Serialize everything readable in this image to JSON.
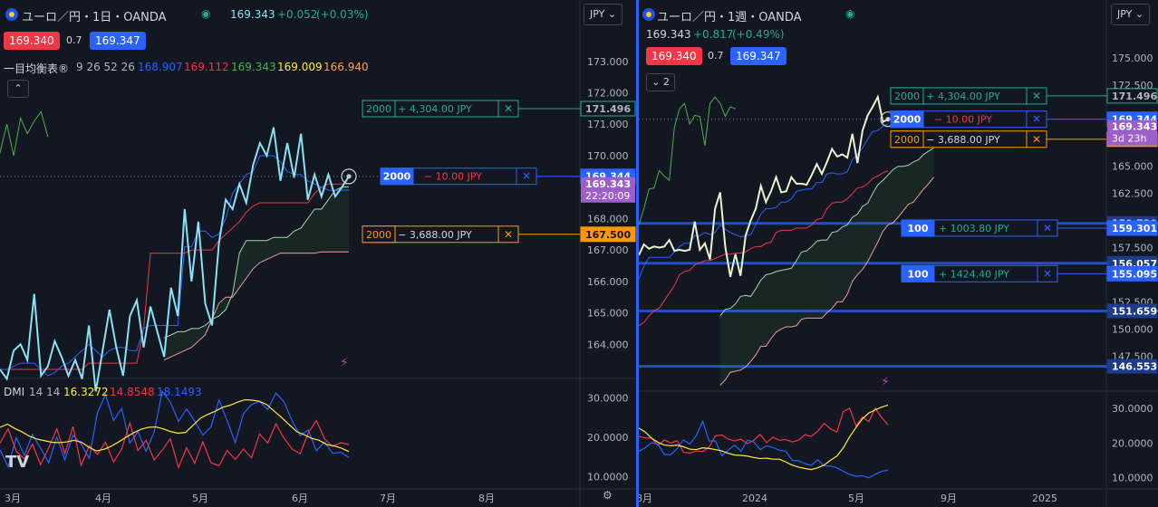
{
  "left": {
    "title": "ユーロ／円・1日・OANDA",
    "last": "169.343",
    "change": "+0.052",
    "change_pct": "(+0.03%)",
    "sell": "169.340",
    "spread": "0.7",
    "buy": "169.347",
    "currency": "JPY",
    "ichimoku_label": "一目均衡表®",
    "ichimoku_params": "9 26 52 26",
    "ichimoku_values": [
      "168.907",
      "169.112",
      "169.343",
      "169.009",
      "166.940"
    ],
    "collapse_icon": "chevron-up-icon",
    "dmi_label": "DMI",
    "dmi_params": "14 14",
    "dmi_values": [
      "16.3272",
      "14.8548",
      "18.1493"
    ],
    "logo": "TV",
    "axis_ticks": [
      "173.000",
      "172.000",
      "171.000",
      "170.000",
      "168.000",
      "167.000",
      "166.000",
      "165.000",
      "164.000"
    ],
    "dmi_ticks": [
      "30.0000",
      "20.0000",
      "10.0000"
    ],
    "x_ticks": [
      "3月",
      "4月",
      "5月",
      "6月",
      "7月",
      "8月"
    ],
    "orders": [
      {
        "qty": "2000",
        "pnl": "+ 4,304.00 JPY",
        "price": "171.496",
        "kind": "tp"
      },
      {
        "qty": "2000",
        "pnl": "− 10.00 JPY",
        "price": "169.344",
        "kind": "entry"
      },
      {
        "qty": "2000",
        "pnl": "− 3,688.00 JPY",
        "price": "167.500",
        "kind": "sl"
      }
    ],
    "price_tag": "169.343",
    "countdown": "22:20:09",
    "colors": {
      "conv": "#2962ff",
      "base": "#f23645",
      "lag": "#4caf50",
      "spanA": "#a5d6a7",
      "spanB": "#ef9a9a",
      "close": "#89e1f5",
      "adx": "#ffeb3b"
    }
  },
  "right": {
    "title": "ユーロ／円・1週・OANDA",
    "last": "169.343",
    "change": "+0.817",
    "change_pct": "(+0.49%)",
    "sell": "169.340",
    "spread": "0.7",
    "buy": "169.347",
    "currency": "JPY",
    "collapsed_count": "2",
    "axis_ticks": [
      "175.000",
      "172.500",
      "165.000",
      "162.500",
      "157.500",
      "152.500",
      "150.000",
      "147.500"
    ],
    "dmi_ticks": [
      "30.0000",
      "20.0000",
      "10.0000"
    ],
    "x_ticks": [
      "8月",
      "2024",
      "5月",
      "9月",
      "2025"
    ],
    "orders": [
      {
        "qty": "2000",
        "pnl": "+ 4,304.00 JPY",
        "price": "171.496",
        "kind": "tp"
      },
      {
        "qty": "2000",
        "pnl": "− 10.00 JPY",
        "price": "169.344",
        "kind": "entry"
      },
      {
        "qty": "2000",
        "pnl": "− 3,688.00 JPY",
        "price": "167.500",
        "kind": "sl"
      },
      {
        "qty": "100",
        "pnl": "+ 1003.80 JPY",
        "price": "159.301",
        "kind": "entry100"
      },
      {
        "qty": "100",
        "pnl": "+ 1424.40 JPY",
        "price": "155.095",
        "kind": "entry100"
      }
    ],
    "hlines": [
      "159.739",
      "156.057",
      "151.659",
      "146.553"
    ],
    "price_tag": "169.343",
    "countdown": "3d 23h"
  },
  "chart_data": [
    {
      "type": "line",
      "title": "ユーロ／円・1日・OANDA",
      "x": [
        "3月",
        "4月",
        "5月",
        "6月",
        "7月",
        "8月"
      ],
      "series": [
        {
          "name": "close",
          "values": [
            163.2,
            162.9,
            163.8,
            164.0,
            163.5,
            165.6,
            163.0,
            163.3,
            164.1,
            163.6,
            163.0,
            163.5,
            162.9,
            164.6,
            162.5,
            163.8,
            165.1,
            163.9,
            163.0,
            164.9,
            165.4,
            163.9,
            165.2,
            164.4,
            163.6,
            165.8,
            164.9,
            168.3,
            166.0,
            167.9,
            165.3,
            164.6,
            167.2,
            168.6,
            168.3,
            169.1,
            168.5,
            169.7,
            170.4,
            170.0,
            170.9,
            169.2,
            170.4,
            169.3,
            170.7,
            168.6,
            169.4,
            168.7,
            169.4,
            168.7,
            169.0,
            169.34
          ]
        },
        {
          "name": "conversion",
          "values": [
            163.2,
            163.2,
            163.3,
            163.4,
            163.4,
            163.4,
            163.2,
            163.0,
            163.1,
            163.3,
            163.4,
            163.6,
            163.8,
            164.0,
            163.8,
            163.6,
            163.8,
            163.9,
            163.9,
            163.8,
            163.8,
            164.5,
            164.6,
            164.6,
            164.6,
            164.6,
            164.6,
            167.1,
            167.1,
            167.6,
            167.6,
            167.4,
            167.5,
            168.0,
            168.8,
            169.1,
            169.4,
            169.5,
            170.0,
            170.0,
            170.0,
            169.8,
            169.5,
            169.4,
            169.4,
            169.2,
            169.1,
            169.0,
            168.9,
            168.9,
            168.9,
            168.907
          ]
        },
        {
          "name": "base",
          "values": [
            163.2,
            163.2,
            163.2,
            163.2,
            163.2,
            163.2,
            163.2,
            163.2,
            163.2,
            163.2,
            163.2,
            163.2,
            163.2,
            163.4,
            163.4,
            163.4,
            163.4,
            163.4,
            163.4,
            163.4,
            163.4,
            164.5,
            166.9,
            166.9,
            166.9,
            166.9,
            166.9,
            166.9,
            167.0,
            167.0,
            167.0,
            167.0,
            167.3,
            167.5,
            167.7,
            167.9,
            168.2,
            168.4,
            168.5,
            168.5,
            168.5,
            168.5,
            168.5,
            168.5,
            168.5,
            168.5,
            168.8,
            169.0,
            169.1,
            169.1,
            169.1,
            169.112
          ]
        },
        {
          "name": "leading_a",
          "values": [
            164.2,
            164.3,
            164.4,
            164.4,
            164.5,
            164.5,
            164.6,
            164.8,
            164.9,
            165.1,
            165.6,
            166.9,
            167.3,
            167.3,
            167.3,
            167.3,
            167.4,
            167.4,
            167.4,
            167.6,
            167.7,
            168.0,
            168.3,
            168.3,
            168.6,
            168.9,
            169.0,
            169.009
          ]
        },
        {
          "name": "leading_b",
          "values": [
            163.5,
            163.6,
            163.7,
            163.8,
            163.9,
            164.1,
            164.3,
            164.8,
            165.3,
            165.5,
            165.5,
            165.8,
            166.1,
            166.4,
            166.6,
            166.7,
            166.8,
            166.9,
            166.9,
            166.9,
            166.9,
            166.9,
            166.9,
            166.94,
            166.94,
            166.94,
            166.94,
            166.94
          ]
        },
        {
          "name": "lagging",
          "values": [
            165.5,
            165.8,
            166.5,
            165.9,
            167.2,
            167.6,
            166.8,
            165.4,
            164.6,
            165.1,
            164.7,
            166.2,
            165.3,
            167.8,
            167.4,
            168.9,
            168.0,
            169.8,
            168.9,
            169.3,
            170.7,
            169.6,
            170.3,
            169.4,
            170.1,
            170.5,
            170.1,
            171.0,
            170.0,
            171.2,
            170.7,
            171.1,
            171.4,
            170.6
          ]
        }
      ],
      "dmi": {
        "adx": [
          22.5,
          23.3,
          22.2,
          21.3,
          20.2,
          19.5,
          19.1,
          18.7,
          18.6,
          18.8,
          19.2,
          18.7,
          17.4,
          16.5,
          16.9,
          17.7,
          18.8,
          20.0,
          21.1,
          22.0,
          22.5,
          22.6,
          22.1,
          21.4,
          21.0,
          21.2,
          23.0,
          24.8,
          25.8,
          26.6,
          27.6,
          28.1,
          28.9,
          29.5,
          29.4,
          29.1,
          28.2,
          26.5,
          24.9,
          23.1,
          21.4,
          20.6,
          19.7,
          19.2,
          18.1,
          17.8,
          17.2,
          16.3272
        ],
        "plus_di": [
          16.8,
          12.5,
          19.9,
          15.4,
          20.7,
          17.2,
          13.5,
          20.0,
          14.2,
          20.5,
          18.3,
          14.6,
          26.1,
          30.8,
          24.2,
          27.3,
          18.5,
          21.4,
          16.4,
          21.3,
          31.6,
          28.9,
          24.0,
          27.2,
          24.1,
          20.5,
          22.6,
          29.5,
          24.2,
          18.6,
          25.9,
          28.3,
          29.1,
          27.0,
          31.2,
          29.0,
          24.2,
          20.4,
          21.8,
          16.5,
          18.8,
          15.9,
          16.1,
          14.8548
        ],
        "minus_di": [
          18.5,
          22.1,
          16.4,
          14.5,
          18.2,
          13.0,
          17.3,
          22.1,
          15.8,
          22.7,
          12.8,
          17.8,
          15.6,
          18.7,
          13.7,
          17.0,
          23.6,
          16.6,
          19.2,
          14.2,
          16.7,
          19.6,
          12.3,
          17.3,
          13.4,
          18.8,
          13.5,
          12.7,
          16.6,
          14.3,
          17.0,
          14.7,
          20.8,
          18.5,
          23.4,
          19.8,
          17.0,
          15.8,
          21.1,
          24.2,
          19.6,
          17.6,
          18.6,
          18.1493
        ],
        "ylim": [
          8,
          34
        ]
      },
      "ylim": [
        163.0,
        173.8
      ]
    },
    {
      "type": "line",
      "title": "ユーロ／円・1週・OANDA",
      "x": [
        "8月",
        "2024",
        "5月",
        "9月",
        "2025"
      ],
      "series": [
        {
          "name": "close",
          "values": [
            156.8,
            157.8,
            157.4,
            157.6,
            157.5,
            157.6,
            158.2,
            157.2,
            157.3,
            157.2,
            157.3,
            159.9,
            157.3,
            157.9,
            156.4,
            161.1,
            162.6,
            157.6,
            154.8,
            156.9,
            154.9,
            158.6,
            160.0,
            161.1,
            163.2,
            161.7,
            162.7,
            164.0,
            162.6,
            162.7,
            164.0,
            163.4,
            163.4,
            163.3,
            164.2,
            165.2,
            164.3,
            165.4,
            166.6,
            165.9,
            166.1,
            165.8,
            168.0,
            165.3,
            168.3,
            169.7,
            170.5,
            171.4,
            169.1,
            169.343
          ]
        },
        {
          "name": "conversion",
          "values": [
            154.6,
            155.8,
            156.6,
            156.6,
            156.6,
            156.6,
            156.6,
            157.1,
            157.6,
            157.9,
            157.9,
            158.6,
            158.6,
            158.9,
            158.7,
            158.9,
            159.6,
            159.2,
            158.9,
            158.7,
            158.5,
            158.6,
            158.7,
            159.6,
            160.6,
            161.1,
            161.1,
            161.2,
            161.7,
            161.7,
            162.0,
            162.7,
            162.8,
            162.9,
            162.9,
            163.5,
            163.5,
            164.3,
            164.4,
            164.3,
            164.3,
            164.5,
            165.6,
            166.1,
            166.7,
            167.5,
            168.2,
            168.3,
            168.7,
            168.907
          ]
        },
        {
          "name": "base",
          "values": [
            150.3,
            150.6,
            151.2,
            151.7,
            151.9,
            152.6,
            153.3,
            154.0,
            155.0,
            155.3,
            155.4,
            155.9,
            156.1,
            156.3,
            156.3,
            156.5,
            156.7,
            156.9,
            156.9,
            157.0,
            157.0,
            157.1,
            157.4,
            157.6,
            157.6,
            157.9,
            158.0,
            158.9,
            159.1,
            159.1,
            159.1,
            159.3,
            159.3,
            159.3,
            159.6,
            160.1,
            160.2,
            161.1,
            161.6,
            161.7,
            161.7,
            162.0,
            162.5,
            163.0,
            163.1,
            163.4,
            163.9,
            164.1,
            164.4,
            164.6
          ]
        },
        {
          "name": "leading_a",
          "values": [
            145.0,
            145.4,
            146.2,
            147.3,
            148.9,
            149.4,
            150.0,
            151.2,
            151.8,
            151.9,
            152.3,
            153.0,
            153.1,
            153.0,
            153.7,
            154.5,
            155.0,
            155.1,
            155.3,
            155.4,
            155.5,
            155.6,
            156.3,
            157.1,
            157.2,
            157.6,
            158.1,
            158.2,
            158.2,
            158.9,
            159.0,
            159.4,
            159.6,
            160.3,
            160.6,
            161.3,
            161.6,
            162.5,
            163.3,
            163.7,
            164.2,
            164.7,
            165.0,
            165.0,
            165.1,
            165.4,
            165.6,
            166.1,
            166.4,
            166.7
          ]
        },
        {
          "name": "leading_b",
          "values": [
            144.8,
            145.3,
            146.0,
            146.1,
            146.2,
            146.5,
            147.0,
            147.6,
            148.4,
            148.4,
            149.1,
            149.7,
            150.0,
            150.2,
            150.2,
            150.3,
            150.9,
            151.0,
            151.0,
            151.0,
            151.0,
            151.5,
            151.9,
            152.5,
            152.5,
            153.2,
            154.4,
            155.0,
            155.5,
            156.2,
            157.1,
            158.0,
            159.0,
            159.6,
            159.8,
            160.3,
            160.9,
            161.5,
            161.7,
            162.3,
            162.9,
            163.4,
            164.0
          ]
        },
        {
          "name": "lagging",
          "values": [
            159.6,
            161.1,
            162.9,
            163.0,
            164.6,
            164.1,
            163.7,
            168.6,
            170.3,
            170.8,
            168.9,
            169.7,
            169.6,
            166.9,
            170.8,
            171.4,
            170.8,
            169.6,
            170.5,
            170.3
          ]
        }
      ],
      "dmi": {
        "adx": [
          24.3,
          23.2,
          21.4,
          20.2,
          19.4,
          19.2,
          19.4,
          18.9,
          18.2,
          18.1,
          18.6,
          18.4,
          18.1,
          17.7,
          17.0,
          16.5,
          16.4,
          16.2,
          15.8,
          15.5,
          15.6,
          15.3,
          15.3,
          14.5,
          13.6,
          13.0,
          12.6,
          12.3,
          12.8,
          13.6,
          15.0,
          16.2,
          18.6,
          21.8,
          24.5,
          27.0,
          28.7,
          29.6,
          30.4,
          31.0
        ],
        "plus_di": [
          21.9,
          21.5,
          21.4,
          19.3,
          20.9,
          20.0,
          20.7,
          17.3,
          17.1,
          17.7,
          17.5,
          18.8,
          22.1,
          22.3,
          21.1,
          20.6,
          21.1,
          19.8,
          20.8,
          22.5,
          20.1,
          21.7,
          20.8,
          21.0,
          20.3,
          20.8,
          22.4,
          21.9,
          23.4,
          25.7,
          24.1,
          23.2,
          29.1,
          30.1,
          24.9,
          27.5,
          26.2,
          30.1,
          27.4,
          25.3
        ],
        "minus_di": [
          17.6,
          18.6,
          20.1,
          19.6,
          16.7,
          16.6,
          18.4,
          20.9,
          19.7,
          22.2,
          26.3,
          20.6,
          20.6,
          16.3,
          17.9,
          19.4,
          17.6,
          20.8,
          20.3,
          18.1,
          19.2,
          18.7,
          17.9,
          17.6,
          15.0,
          14.8,
          14.0,
          13.5,
          15.1,
          13.4,
          13.3,
          12.8,
          11.8,
          10.9,
          10.3,
          10.5,
          9.9,
          10.9,
          11.8,
          12.1
        ],
        "ylim": [
          8,
          34
        ]
      },
      "ylim": [
        144.6,
        177.0
      ]
    }
  ]
}
